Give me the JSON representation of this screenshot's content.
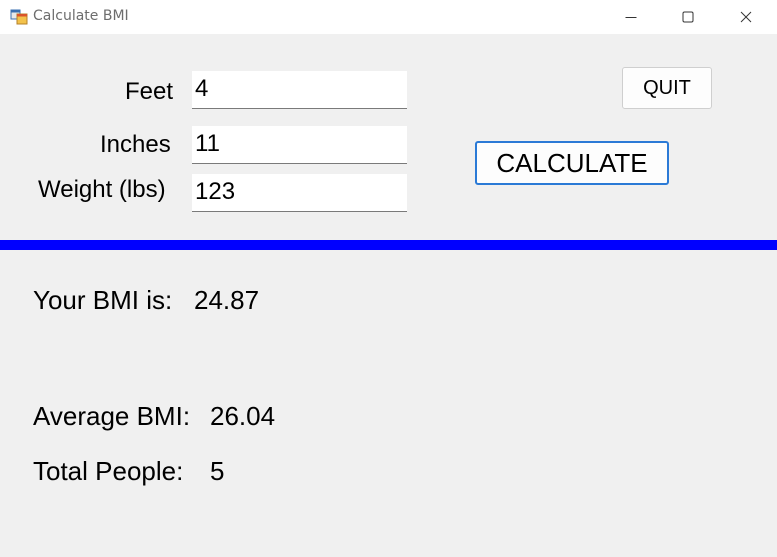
{
  "window": {
    "title": "Calculate BMI"
  },
  "form": {
    "feet": {
      "label": "Feet",
      "value": "4"
    },
    "inches": {
      "label": "Inches",
      "value": "11"
    },
    "weight": {
      "label": "Weight (lbs)",
      "value": "123"
    }
  },
  "buttons": {
    "quit": "QUIT",
    "calculate": "CALCULATE"
  },
  "results": {
    "bmi_label": "Your BMI is:",
    "bmi_value": "24.87",
    "avg_label": "Average BMI:",
    "avg_value": "26.04",
    "total_label": "Total People:",
    "total_value": "5"
  },
  "colors": {
    "divider": "#0000ff",
    "calculate_border": "#2b7ad6"
  },
  "icons": {
    "app": "app-form-icon",
    "minimize": "minimize-icon",
    "maximize": "maximize-icon",
    "close": "close-icon"
  }
}
